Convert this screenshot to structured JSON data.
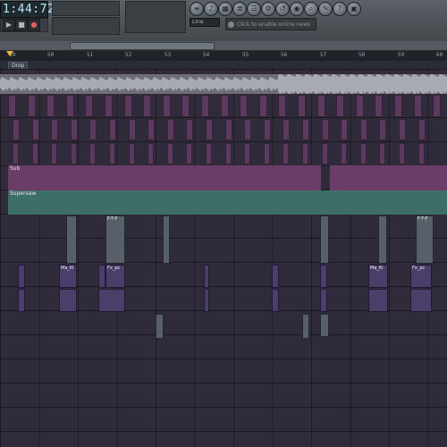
{
  "toolbar": {
    "song_time": "1:44:72",
    "snap_label": "Line",
    "hint_text": "Click to enable online news"
  },
  "ruler": {
    "bars": [
      "49",
      "50",
      "51",
      "52",
      "53",
      "54",
      "55",
      "56",
      "57",
      "58",
      "59",
      "60"
    ]
  },
  "markers": {
    "drop_label": "Drop"
  },
  "tracks": {
    "sub_label": "Sub",
    "supersaw_label": "Supersaw",
    "auto_labels": [
      "F-T-F",
      "Fx_pc",
      "Ma_Kl",
      "Ma_Kl",
      "F-T-F"
    ]
  },
  "colors": {
    "background": "#2e2a38",
    "pink_clip": "#c9a3c8",
    "sub_lane": "#6a3d68",
    "supersaw_lane": "#3e6e68",
    "marker": "#f0b43a"
  }
}
